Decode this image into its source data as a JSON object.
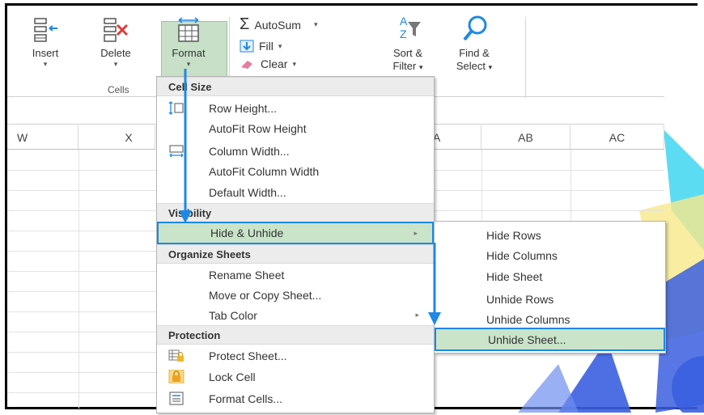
{
  "ribbon": {
    "insert_label": "Insert",
    "delete_label": "Delete",
    "format_label": "Format",
    "cells_group_label": "Cells",
    "autosum_label": "AutoSum",
    "fill_label": "Fill",
    "clear_label": "Clear",
    "sort_label_1": "Sort &",
    "sort_label_2": "Filter",
    "find_label_1": "Find &",
    "find_label_2": "Select",
    "dropdown_glyph": "▾"
  },
  "columns": {
    "w": "W",
    "x": "X",
    "aa": "A",
    "ab": "AB",
    "ac": "AC"
  },
  "format_menu": {
    "header_cell_size": "Cell Size",
    "row_height": "Row Height...",
    "autofit_row_height": "AutoFit Row Height",
    "column_width": "Column Width...",
    "autofit_column_width": "AutoFit Column Width",
    "default_width": "Default Width...",
    "header_visibility": "Visibility",
    "hide_unhide": "Hide & Unhide",
    "header_organize": "Organize Sheets",
    "rename_sheet": "Rename Sheet",
    "move_copy_sheet": "Move or Copy Sheet...",
    "tab_color": "Tab Color",
    "header_protection": "Protection",
    "protect_sheet": "Protect Sheet...",
    "lock_cell": "Lock Cell",
    "format_cells": "Format Cells...",
    "submenu_arrow": "▸"
  },
  "hide_submenu": {
    "hide_rows": "Hide Rows",
    "hide_columns": "Hide Columns",
    "hide_sheet": "Hide Sheet",
    "unhide_rows": "Unhide Rows",
    "unhide_columns": "Unhide Columns",
    "unhide_sheet": "Unhide Sheet..."
  },
  "colors": {
    "highlight_green": "#c9e4c9",
    "arrow_blue": "#1e88e5",
    "menu_header_bg": "#ececec"
  }
}
